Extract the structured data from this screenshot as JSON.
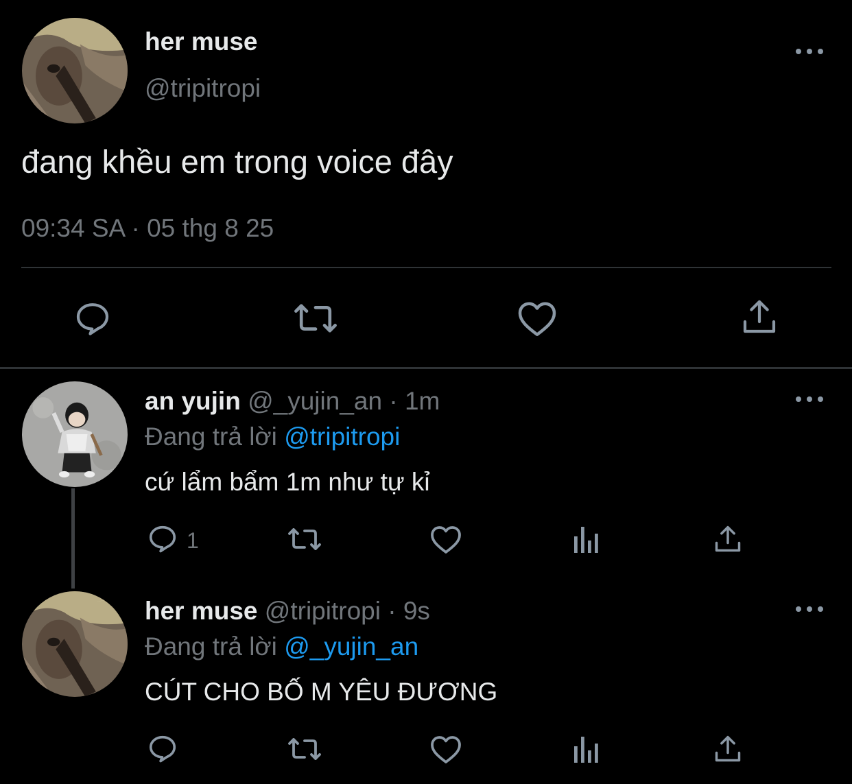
{
  "main_tweet": {
    "author_name": "her muse",
    "author_handle": "@tripitropi",
    "text": "đang khều em trong voice đây",
    "timestamp": "09:34 SA · 05 thg 8 25",
    "actions": [
      "reply-icon",
      "retweet-icon",
      "like-icon",
      "share-icon"
    ]
  },
  "replies": [
    {
      "author_name": "an yujin",
      "author_handle": "@_yujin_an",
      "time": "· 1m",
      "replying_prefix": "Đang trả lời",
      "replying_to": "@tripitropi",
      "text": "cứ lẩm bẩm 1m như tự kỉ",
      "reply_count": "1",
      "actions": [
        "reply-icon",
        "retweet-icon",
        "like-icon",
        "views-icon",
        "share-icon"
      ]
    },
    {
      "author_name": "her muse",
      "author_handle": "@tripitropi",
      "time": "· 9s",
      "replying_prefix": "Đang trả lời",
      "replying_to": "@_yujin_an",
      "text": "CÚT CHO BỐ M YÊU ĐƯƠNG",
      "reply_count": "",
      "actions": [
        "reply-icon",
        "retweet-icon",
        "like-icon",
        "views-icon",
        "share-icon"
      ]
    }
  ],
  "colors": {
    "background": "#000000",
    "primary_text": "#e7e9ea",
    "secondary_text": "#71767b",
    "icon": "#8b98a5",
    "mention": "#1d9bf0",
    "divider": "#2f3336"
  }
}
